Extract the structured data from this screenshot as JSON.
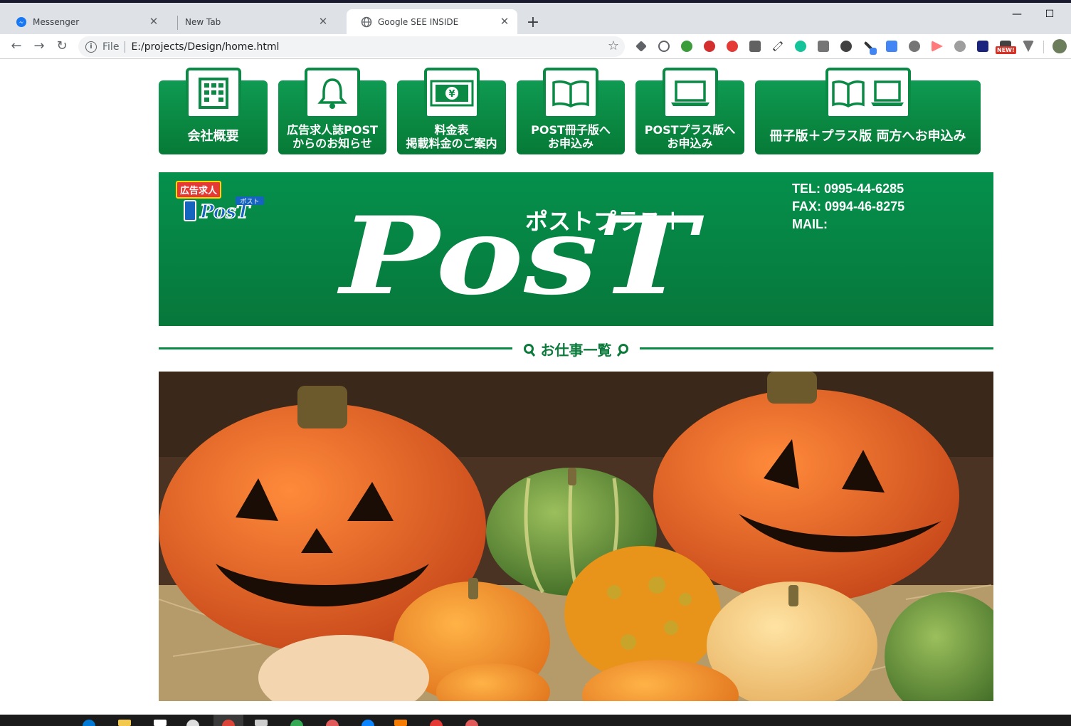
{
  "browser": {
    "tabs": [
      {
        "title": "Messenger",
        "active": false
      },
      {
        "title": "New Tab",
        "active": false
      },
      {
        "title": "Google SEE INSIDE",
        "active": true
      }
    ],
    "url_scheme": "File",
    "url": "E:/projects/Design/home.html",
    "new_badge": "NEW!"
  },
  "nav": [
    {
      "label_lines": [
        "会社概要"
      ],
      "icon": "building-icon"
    },
    {
      "label_lines": [
        "広告求人誌POST",
        "からのお知らせ"
      ],
      "icon": "bell-icon"
    },
    {
      "label_lines": [
        "料金表",
        "掲載料金のご案内"
      ],
      "icon": "yen-bill-icon"
    },
    {
      "label_lines": [
        "POST冊子版へ",
        "お申込み"
      ],
      "icon": "book-icon"
    },
    {
      "label_lines": [
        "POSTプラス版へ",
        "お申込み"
      ],
      "icon": "laptop-icon"
    },
    {
      "label_lines": [
        "冊子版＋プラス版 両方へお申込み"
      ],
      "icon": "book-laptop-icon"
    }
  ],
  "banner": {
    "badge": "広告求人",
    "mini_logo_sub": "ポスト",
    "mini_logo": "PosT",
    "plus_text": "ポストプラス＋",
    "big_logo": "PosT",
    "tel": "TEL: 0995-44-6285",
    "fax": "FAX: 0994-46-8275",
    "mail": "MAIL:"
  },
  "section": {
    "title": "お仕事一覧"
  },
  "colors": {
    "brand_green": "#0a8a45",
    "pumpkin_orange": "#e8621c"
  }
}
